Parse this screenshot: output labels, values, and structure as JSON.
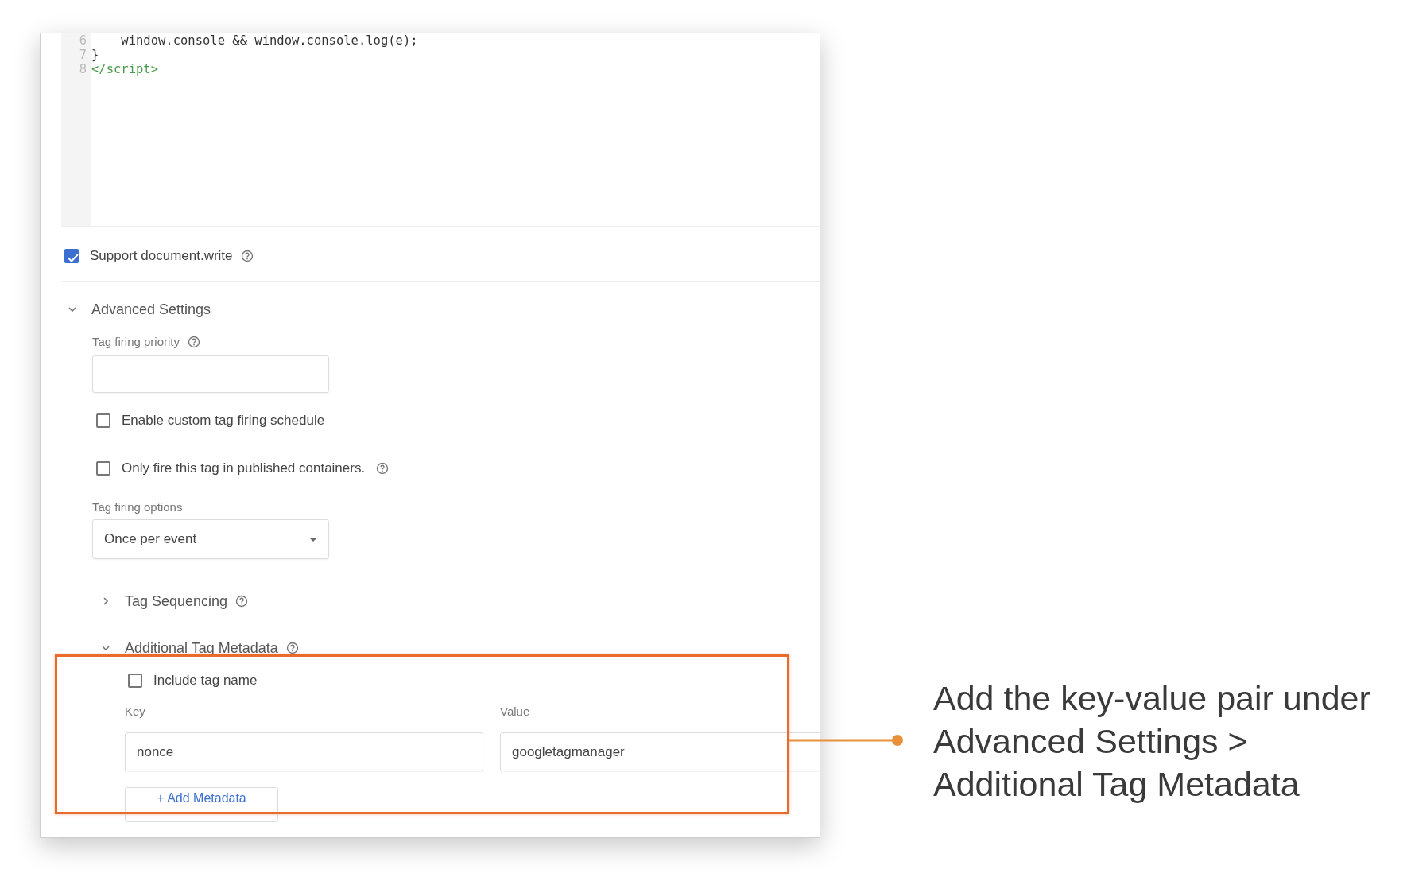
{
  "code_editor": {
    "lines": [
      {
        "number": "6",
        "code": "    window.console && window.console.log(e);",
        "kind": "plain"
      },
      {
        "number": "7",
        "code": "}",
        "kind": "plain"
      },
      {
        "number": "8",
        "code": "</script>",
        "kind": "tag"
      }
    ]
  },
  "support_document_write": {
    "label": "Support document.write",
    "checked": true,
    "help": true
  },
  "advanced_settings": {
    "title": "Advanced Settings",
    "expanded": true,
    "help": false,
    "tag_firing_priority": {
      "label": "Tag firing priority",
      "help": true
    },
    "options": [
      {
        "label": "Enable custom tag firing schedule",
        "checked": false,
        "help": false
      },
      {
        "label": "Only fire this tag in published containers.",
        "checked": false,
        "help": true
      }
    ],
    "tag_firing_options": {
      "label": "Tag firing options",
      "value": "Once per event"
    },
    "tag_sequencing": {
      "title": "Tag Sequencing",
      "expanded": false,
      "help": true
    },
    "additional_tag_metadata": {
      "title": "Additional Tag Metadata",
      "expanded": true,
      "help": true,
      "include_tag_name": {
        "label": "Include tag name",
        "checked": false
      },
      "key_label": "Key",
      "value_label": "Value",
      "rows": [
        {
          "key": "nonce",
          "value": "googletagmanager"
        }
      ],
      "add_button": "+ Add Metadata"
    }
  },
  "callout": {
    "lines": [
      "Add the key-value pair under",
      "Advanced Settings >",
      "Additional Tag Metadata"
    ]
  }
}
